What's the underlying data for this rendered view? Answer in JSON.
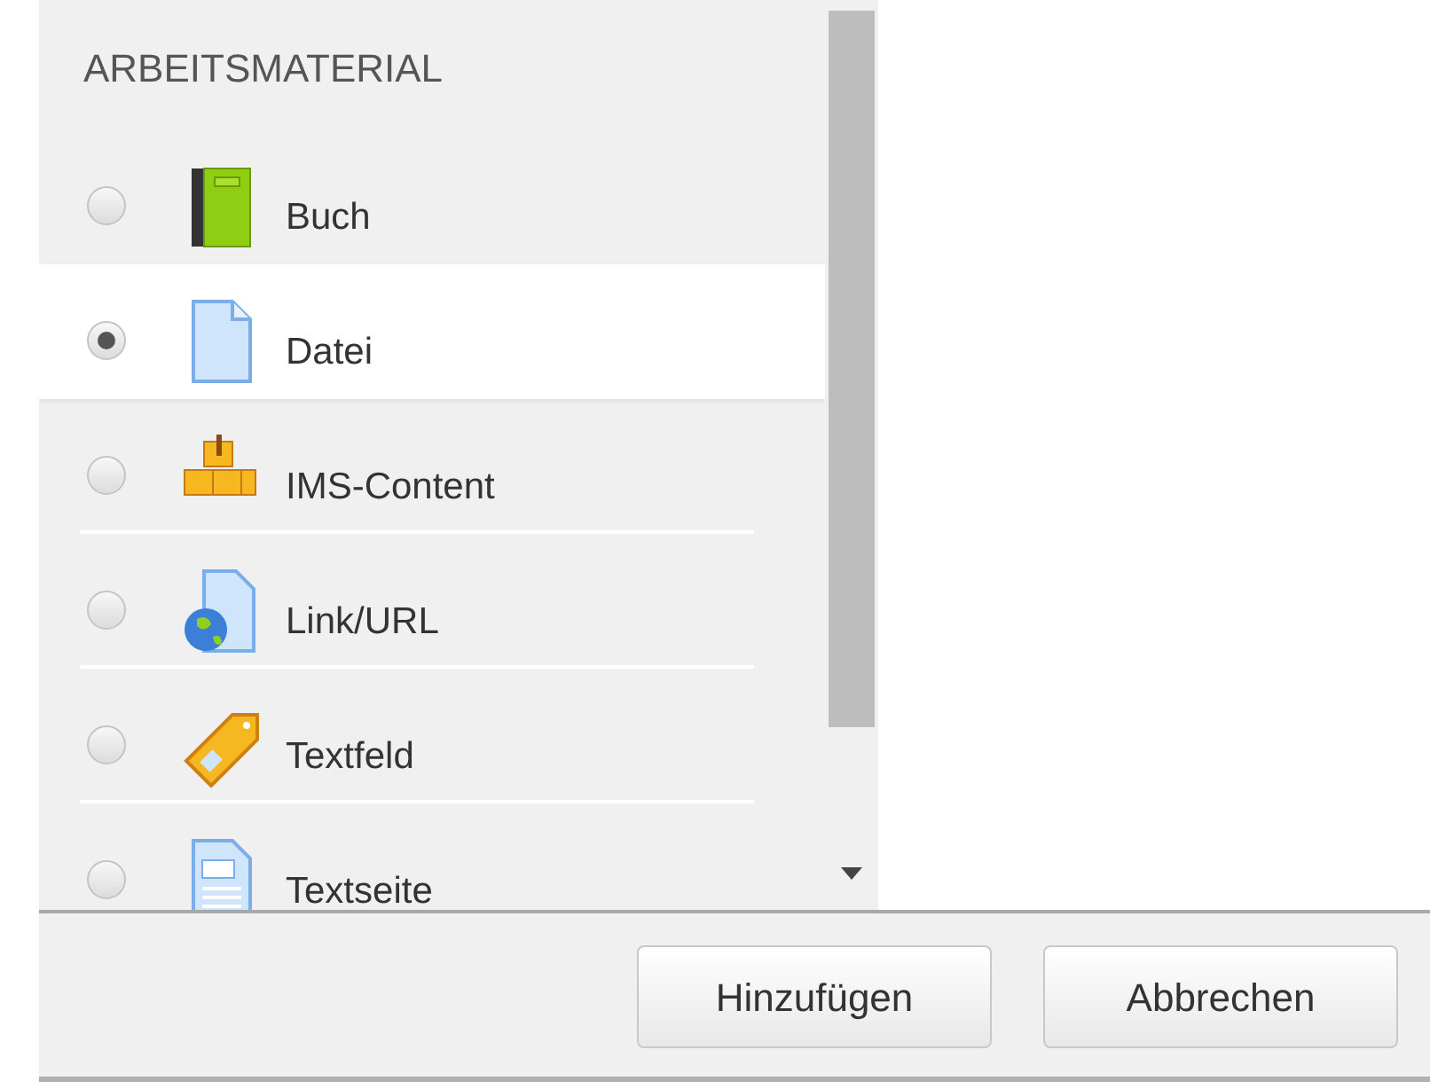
{
  "section": {
    "heading": "ARBEITSMATERIAL"
  },
  "items": [
    {
      "kind": "book",
      "label": "Buch",
      "selected": false
    },
    {
      "kind": "file",
      "label": "Datei",
      "selected": true
    },
    {
      "kind": "package",
      "label": "IMS-Content",
      "selected": false
    },
    {
      "kind": "url",
      "label": "Link/URL",
      "selected": false
    },
    {
      "kind": "label",
      "label": "Textfeld",
      "selected": false
    },
    {
      "kind": "page",
      "label": "Textseite",
      "selected": false
    }
  ],
  "buttons": [
    {
      "label": "Hinzufügen"
    },
    {
      "label": "Abbrechen"
    }
  ]
}
